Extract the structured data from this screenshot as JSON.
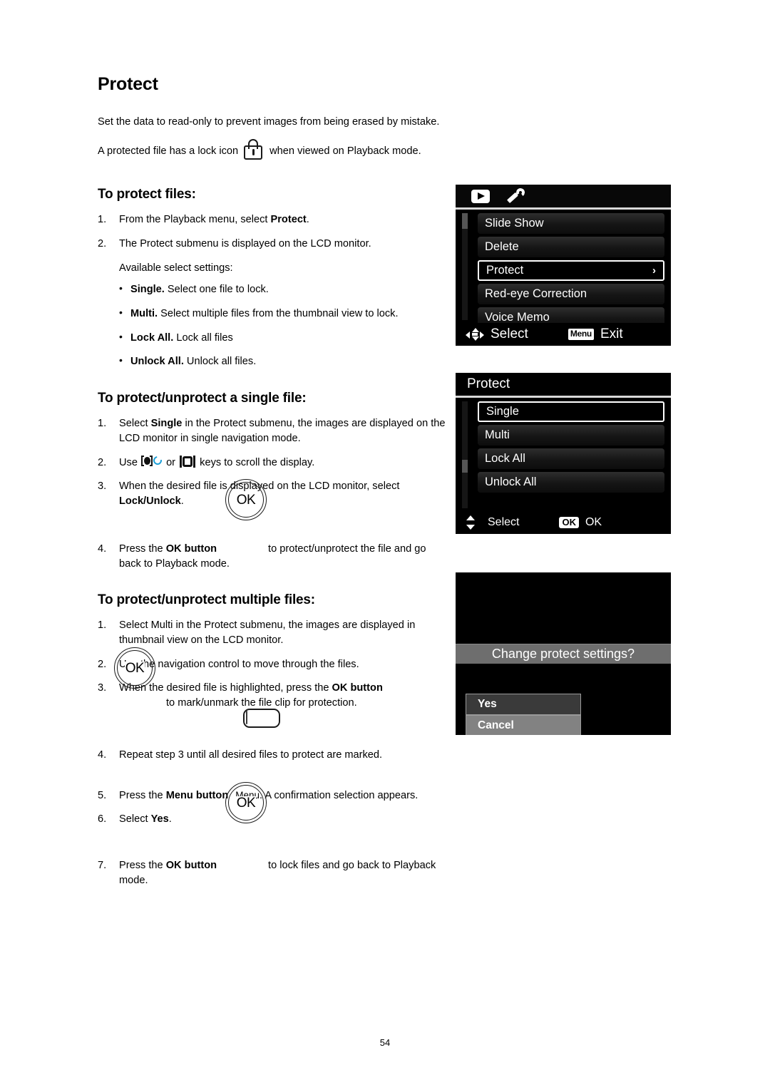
{
  "document": {
    "title": "Protect",
    "page_number": "54",
    "intro": [
      "Set the data to read-only to prevent images from being erased by mistake.",
      "A protected file has a lock icon"
    ],
    "intro_lock_suffix": "when viewed on Playback mode."
  },
  "section_protect_files": {
    "heading": "To protect files:",
    "steps": [
      {
        "num": "1.",
        "text_before_bold": "From the Playback menu, select ",
        "bold": "Protect",
        "text_after_bold": "."
      },
      {
        "num": "2.",
        "text_before_bold": "The Protect submenu is displayed on the LCD monitor.",
        "bold": "",
        "text_after_bold": ""
      }
    ],
    "available_label": "Available select settings:",
    "bullets": [
      {
        "bold": "Single.",
        "text": " Select one file to lock."
      },
      {
        "bold": "Multi.",
        "text": " Select multiple files from the thumbnail view to lock."
      },
      {
        "bold": "Lock All.",
        "text": " Lock all files"
      },
      {
        "bold": "Unlock All.",
        "text": " Unlock all files."
      }
    ]
  },
  "section_single_file": {
    "heading": "To protect/unprotect a single file:",
    "step1": {
      "num": "1.",
      "part1": "Select ",
      "bold": "Single",
      "part2": " in the Protect submenu, the images are displayed on the LCD monitor in single navigation mode."
    },
    "step2": {
      "num": "2.",
      "part1": "Use ",
      "part2": " or ",
      "part3": " keys to scroll the display."
    },
    "step3": {
      "num": "3.",
      "part1": "When the desired file is displayed on the LCD monitor, select ",
      "bold": "Lock/Unlock",
      "part2": "."
    },
    "step4": {
      "num": "4.",
      "part1": "Press the ",
      "bold": "OK button",
      "part2": "to protect/unprotect the file and go back to Playback mode.",
      "button_label": "OK"
    }
  },
  "section_multiple_files": {
    "heading": "To protect/unprotect multiple files:",
    "step1": {
      "num": "1.",
      "text": "Select Multi in the Protect submenu, the images are displayed in thumbnail view on the LCD monitor."
    },
    "step2": {
      "num": "2.",
      "text": "Use the navigation control to move through the files."
    },
    "step3": {
      "num": "3.",
      "part1": "When the desired file is highlighted, press the ",
      "bold": "OK button",
      "part2": "to mark/unmark the file clip for protection.",
      "button_label": "OK"
    },
    "step4": {
      "num": "4.",
      "text": "Repeat step 3 until all desired files to protect are marked."
    },
    "step5": {
      "num": "5.",
      "part1": "Press the ",
      "bold": "Menu button",
      "menu_word": "Menu",
      "part2": ". A confirmation selection appears."
    },
    "step6": {
      "num": "6.",
      "part1": "Select ",
      "bold": "Yes",
      "part2": "."
    },
    "step7": {
      "num": "7.",
      "part1": "Press the ",
      "bold": "OK button",
      "part2": "to lock files and go back to Playback mode.",
      "button_label": "OK"
    }
  },
  "lcd_playback_menu": {
    "tabs": [
      {
        "icon": "play-icon",
        "name": "playback-tab"
      },
      {
        "icon": "wrench-icon",
        "name": "setup-tab"
      }
    ],
    "items": [
      {
        "label": "Slide Show",
        "selected": false,
        "chevron": ""
      },
      {
        "label": "Delete",
        "selected": false,
        "chevron": ""
      },
      {
        "label": "Protect",
        "selected": true,
        "chevron": "›"
      },
      {
        "label": "Red-eye Correction",
        "selected": false,
        "chevron": ""
      },
      {
        "label": "Voice Memo",
        "selected": false,
        "chevron": ""
      }
    ],
    "footer": {
      "select_label": "Select",
      "menu_badge": "Menu",
      "exit_label": "Exit"
    }
  },
  "lcd_protect_menu": {
    "header": "Protect",
    "items": [
      {
        "label": "Single",
        "selected": true
      },
      {
        "label": "Multi",
        "selected": false
      },
      {
        "label": "Lock All",
        "selected": false
      },
      {
        "label": "Unlock All",
        "selected": false
      }
    ],
    "footer": {
      "select_label": "Select",
      "ok_badge": "OK",
      "ok_label": "OK"
    }
  },
  "lcd_confirm": {
    "message": "Change protect settings?",
    "options": [
      {
        "label": "Yes",
        "highlighted": false
      },
      {
        "label": "Cancel",
        "highlighted": true
      }
    ]
  },
  "colors": {
    "accent_blue": "#1b9fd8",
    "lcd_background": "#000000",
    "lcd_text": "#ffffff",
    "highlight_gray": "#828282"
  }
}
